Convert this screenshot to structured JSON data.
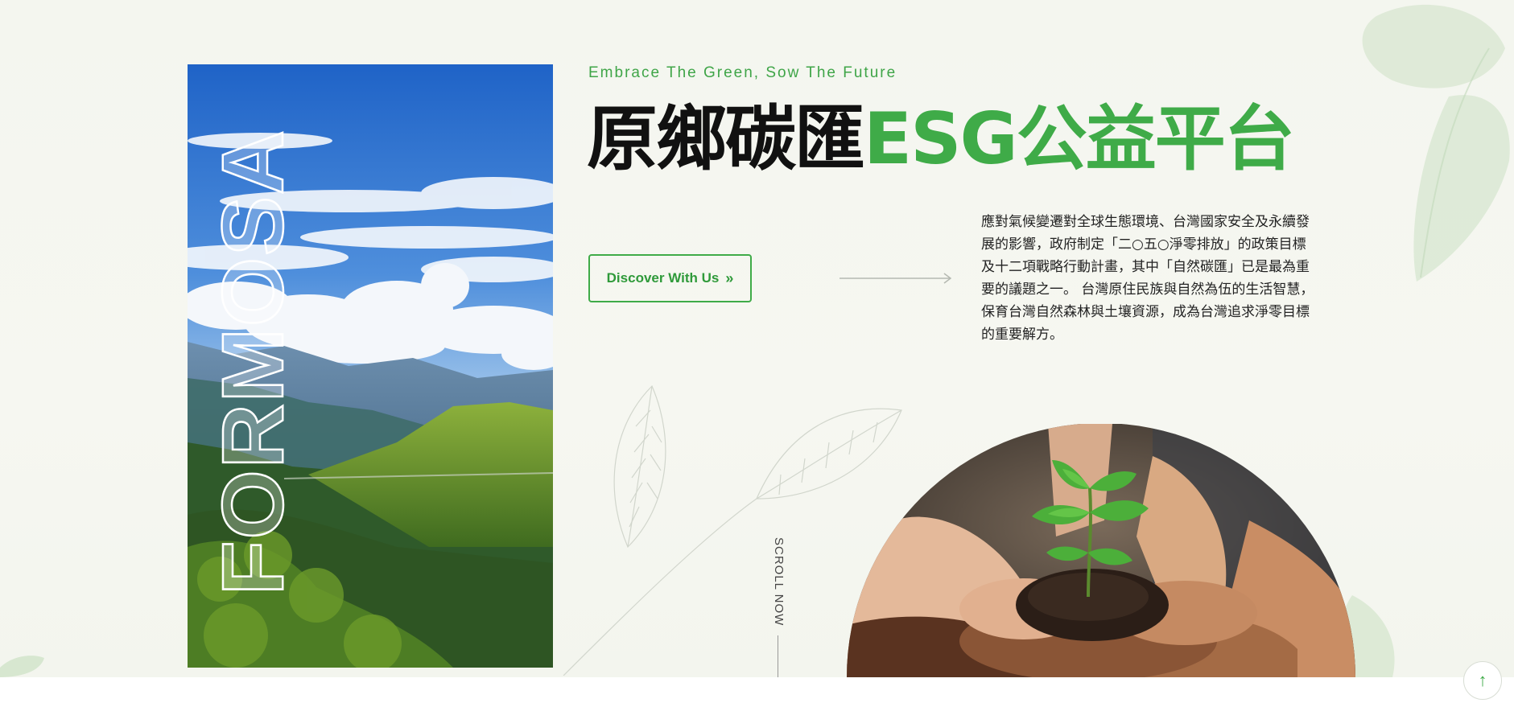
{
  "hero": {
    "tagline": "Embrace The Green, Sow The Future",
    "title_black": "原鄉碳匯",
    "title_green": "ESG公益平台",
    "cta_label": "Discover With Us",
    "cta_icon": "double-chevron-right-icon",
    "description": "應對氣候變遷對全球生態環境、台灣國家安全及永續發展的影響，政府制定「二○五○淨零排放」的政策目標及十二項戰略行動計畫，其中「自然碳匯」已是最為重要的議題之一。 台灣原住民族與自然為伍的生活智慧， 保育台灣自然森林與土壤資源，成為台灣追求淨零目標的重要解方。",
    "vertical_word": "FORMOSA",
    "scroll_label": "SCROLL NOW"
  },
  "back_to_top_icon": "arrow-up-icon",
  "colors": {
    "brand_green": "#3fab48",
    "title_black": "#111111",
    "background": "#f5f6f0"
  }
}
